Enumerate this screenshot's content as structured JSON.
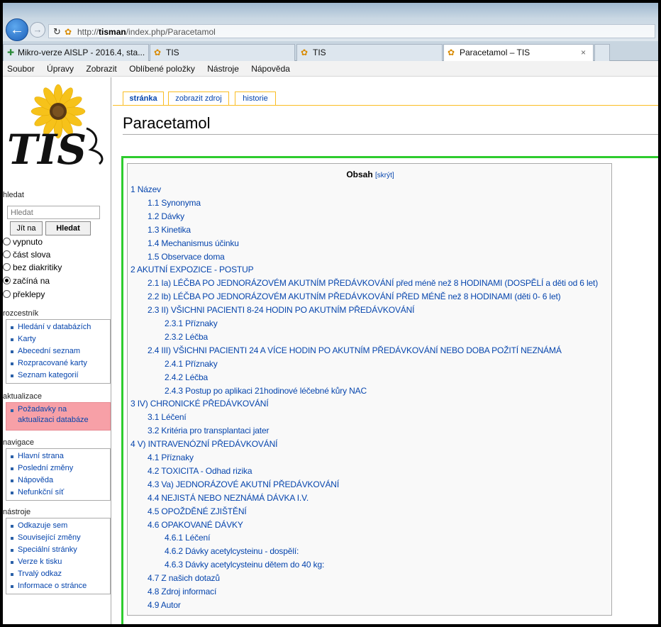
{
  "browser": {
    "url_prefix": "http://",
    "url_host": "tisman",
    "url_path": "/index.php/Paracetamol",
    "tabs": [
      {
        "label": "Mikro-verze AISLP - 2016.4, sta..."
      },
      {
        "label": "TIS"
      },
      {
        "label": "TIS"
      },
      {
        "label": "Paracetamol – TIS",
        "close": "×"
      }
    ],
    "menu": [
      "Soubor",
      "Úpravy",
      "Zobrazit",
      "Oblíbené položky",
      "Nástroje",
      "Nápověda"
    ]
  },
  "sidebar": {
    "logo_text": "TIS",
    "search_heading": "hledat",
    "search_placeholder": "Hledat",
    "go_button": "Jít na",
    "search_button": "Hledat",
    "radio_options": [
      {
        "label": "vypnuto",
        "checked": false
      },
      {
        "label": "část slova",
        "checked": false
      },
      {
        "label": "bez diakritiky",
        "checked": false
      },
      {
        "label": "začíná na",
        "checked": true
      },
      {
        "label": "překlepy",
        "checked": false
      }
    ],
    "sections": [
      {
        "heading": "rozcestník",
        "items": [
          "Hledání v databázích",
          "Karty",
          "Abecední seznam",
          "Rozpracované karty",
          "Seznam kategorií"
        ]
      },
      {
        "heading": "aktualizace",
        "items": [
          "Požadavky na aktualizaci databáze"
        ]
      },
      {
        "heading": "navigace",
        "items": [
          "Hlavní strana",
          "Poslední změny",
          "Nápověda",
          "Nefunkční síť"
        ]
      },
      {
        "heading": "nástroje",
        "items": [
          "Odkazuje sem",
          "Související změny",
          "Speciální stránky",
          "Verze k tisku",
          "Trvalý odkaz",
          "Informace o stránce"
        ]
      }
    ]
  },
  "page": {
    "tabs": [
      "stránka",
      "zobrazit zdroj",
      "historie"
    ],
    "title": "Paracetamol"
  },
  "toc": {
    "title": "Obsah",
    "toggle": "[skrýt]",
    "items": [
      {
        "level": 1,
        "text": "1 Název"
      },
      {
        "level": 2,
        "text": "1.1 Synonyma"
      },
      {
        "level": 2,
        "text": "1.2 Dávky"
      },
      {
        "level": 2,
        "text": "1.3 Kinetika"
      },
      {
        "level": 2,
        "text": "1.4 Mechanismus účinku"
      },
      {
        "level": 2,
        "text": "1.5 Observace doma"
      },
      {
        "level": 1,
        "text": "2 AKUTNÍ EXPOZICE - POSTUP"
      },
      {
        "level": 2,
        "text": "2.1 Ia) LÉČBA PO JEDNORÁZOVÉM AKUTNÍM PŘEDÁVKOVÁNÍ před méně než 8 HODINAMI (DOSPĚLÍ a děti od 6 let)"
      },
      {
        "level": 2,
        "text": "2.2 Ib) LÉČBA PO JEDNORÁZOVÉM AKUTNÍM PŘEDÁVKOVÁNÍ PŘED MÉNĚ než 8 HODINAMI (děti 0- 6 let)"
      },
      {
        "level": 2,
        "text": "2.3 II) VŠICHNI PACIENTI 8-24 HODIN PO AKUTNÍM PŘEDÁVKOVÁNÍ"
      },
      {
        "level": 3,
        "text": "2.3.1 Příznaky"
      },
      {
        "level": 3,
        "text": "2.3.2 Léčba"
      },
      {
        "level": 2,
        "text": "2.4 III) VŠICHNI PACIENTI 24 A VÍCE HODIN PO AKUTNÍM PŘEDÁVKOVÁNÍ NEBO DOBA POŽITÍ NEZNÁMÁ"
      },
      {
        "level": 3,
        "text": "2.4.1 Příznaky"
      },
      {
        "level": 3,
        "text": "2.4.2 Léčba"
      },
      {
        "level": 3,
        "text": "2.4.3 Postup po aplikaci 21hodinové léčebné kůry NAC"
      },
      {
        "level": 1,
        "text": "3 IV) CHRONICKÉ PŘEDÁVKOVÁNÍ"
      },
      {
        "level": 2,
        "text": "3.1 Léčení"
      },
      {
        "level": 2,
        "text": "3.2 Kritéria pro transplantaci jater"
      },
      {
        "level": 1,
        "text": "4 V) INTRAVENÓZNÍ PŘEDÁVKOVÁNÍ"
      },
      {
        "level": 2,
        "text": "4.1 Příznaky"
      },
      {
        "level": 2,
        "text": "4.2 TOXICITA - Odhad rizika"
      },
      {
        "level": 2,
        "text": "4.3 Va) JEDNORÁZOVÉ AKUTNÍ PŘEDÁVKOVÁNÍ"
      },
      {
        "level": 2,
        "text": "4.4 NEJISTÁ NEBO NEZNÁMÁ DÁVKA I.V."
      },
      {
        "level": 2,
        "text": "4.5 OPOŽDĚNÉ ZJIŠTĚNÍ"
      },
      {
        "level": 2,
        "text": "4.6 OPAKOVANÉ DÁVKY"
      },
      {
        "level": 3,
        "text": "4.6.1 Léčení"
      },
      {
        "level": 3,
        "text": "4.6.2 Dávky acetylcysteinu - dospělí:"
      },
      {
        "level": 3,
        "text": "4.6.3 Dávky acetylcysteinu dětem do 40 kg:"
      },
      {
        "level": 2,
        "text": "4.7 Z našich dotazů"
      },
      {
        "level": 2,
        "text": "4.8 Zdroj informací"
      },
      {
        "level": 2,
        "text": "4.9 Autor"
      }
    ]
  }
}
